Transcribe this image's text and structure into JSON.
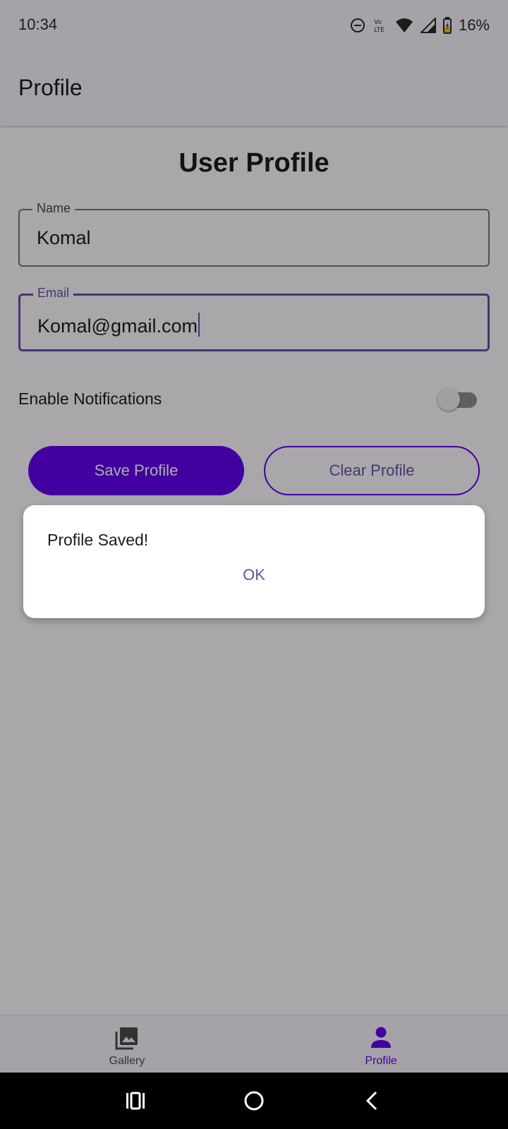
{
  "status_bar": {
    "time": "10:34",
    "battery": "16%",
    "icons": [
      "do-not-disturb-icon",
      "volte-icon",
      "wifi-icon",
      "signal-icon",
      "battery-charging-icon"
    ]
  },
  "app_bar": {
    "title": "Profile"
  },
  "profile_form": {
    "heading": "User Profile",
    "name_field": {
      "label": "Name",
      "value": "Komal"
    },
    "email_field": {
      "label": "Email",
      "value": "Komal@gmail.com"
    },
    "notifications": {
      "label": "Enable Notifications",
      "enabled": false
    },
    "save_label": "Save Profile",
    "clear_label": "Clear Profile"
  },
  "dialog": {
    "message": "Profile Saved!",
    "ok_label": "OK"
  },
  "bottom_nav": {
    "items": [
      {
        "label": "Gallery",
        "icon": "gallery-icon",
        "selected": false
      },
      {
        "label": "Profile",
        "icon": "person-icon",
        "selected": true
      }
    ]
  },
  "colors": {
    "primary": "#6200ee",
    "accent_text": "#6750a4",
    "scrim": "rgba(0,0,0,0.32)"
  }
}
